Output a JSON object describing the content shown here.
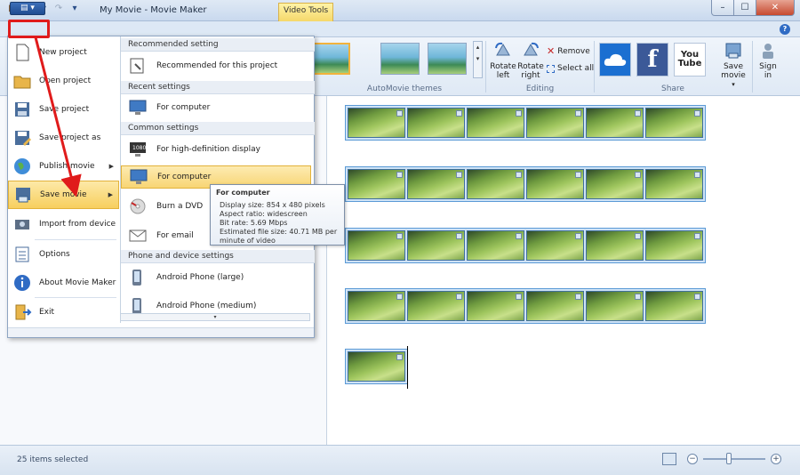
{
  "window": {
    "title": "My Movie - Movie Maker",
    "contextual_tab": "Video Tools",
    "minimize": "–",
    "maximize": "☐",
    "close": "✕",
    "help": "?"
  },
  "app_menu_button": "▤ ▾",
  "ribbon": {
    "groups": {
      "themes": "AutoMovie themes",
      "editing": "Editing",
      "share": "Share"
    },
    "editing": {
      "rotate_left": "Rotate left",
      "rotate_right": "Rotate right",
      "remove": "Remove",
      "select_all": "Select all"
    },
    "share": {
      "save_movie": "Save movie",
      "sign_in": "Sign in",
      "facebook": "f",
      "youtube": "You Tube"
    }
  },
  "app_menu": {
    "items": [
      {
        "label": "New project"
      },
      {
        "label": "Open project"
      },
      {
        "label": "Save project"
      },
      {
        "label": "Save project as"
      },
      {
        "label": "Publish movie"
      },
      {
        "label": "Save movie"
      },
      {
        "label": "Import from device"
      },
      {
        "label": "Options"
      },
      {
        "label": "About Movie Maker"
      },
      {
        "label": "Exit"
      }
    ],
    "sections": {
      "recommended": "Recommended setting",
      "recent": "Recent settings",
      "common": "Common settings",
      "phone": "Phone and device settings"
    },
    "sub_items": {
      "recommended_project": "Recommended for this project",
      "recent_computer": "For computer",
      "hd_display": "For high-definition display",
      "computer": "For computer",
      "dvd": "Burn a DVD",
      "email": "For email",
      "android_large": "Android Phone (large)",
      "android_medium": "Android Phone (medium)"
    }
  },
  "tooltip": {
    "title": "For computer",
    "lines": [
      "Display size: 854 x 480 pixels",
      "Aspect ratio: widescreen",
      "Bit rate: 5.69 Mbps",
      "Estimated file size: 40.71 MB per",
      "minute of video"
    ]
  },
  "status": {
    "items_selected": "25 items selected",
    "zoom_out": "−",
    "zoom_in": "+"
  },
  "colors": {
    "accent": "#2f6bc4",
    "annotation": "#e01b1b",
    "highlight": "#f7cf5e"
  }
}
